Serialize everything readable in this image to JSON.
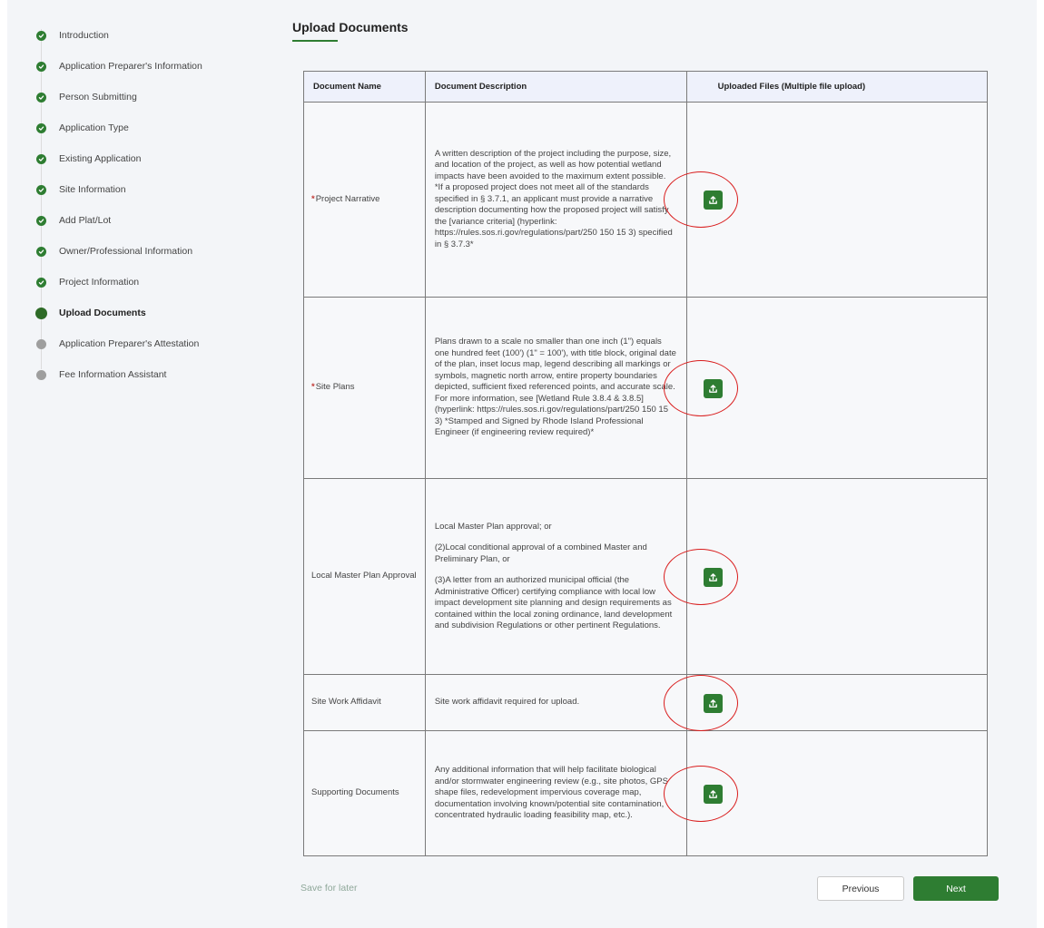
{
  "steps": [
    {
      "label": "Introduction",
      "status": "done"
    },
    {
      "label": "Application Preparer's Information",
      "status": "done"
    },
    {
      "label": "Person Submitting",
      "status": "done"
    },
    {
      "label": "Application Type",
      "status": "done"
    },
    {
      "label": "Existing Application",
      "status": "done"
    },
    {
      "label": "Site Information",
      "status": "done"
    },
    {
      "label": "Add Plat/Lot",
      "status": "done"
    },
    {
      "label": "Owner/Professional Information",
      "status": "done"
    },
    {
      "label": "Project Information",
      "status": "done"
    },
    {
      "label": "Upload Documents",
      "status": "current"
    },
    {
      "label": "Application Preparer's Attestation",
      "status": "todo"
    },
    {
      "label": "Fee Information Assistant",
      "status": "todo"
    }
  ],
  "page_title": "Upload Documents",
  "table": {
    "headers": {
      "name": "Document Name",
      "description": "Document Description",
      "files": "Uploaded Files (Multiple file upload)"
    },
    "rows": [
      {
        "required": true,
        "name": "Project Narrative",
        "description": [
          "A written description of the project including the purpose, size, and location of the project, as well as how potential wetland impacts have been avoided to the maximum extent possible.",
          "*If a proposed project does not meet all of the standards specified in § 3.7.1, an applicant must provide a narrative description documenting how the proposed project will satisfy the [variance criteria] (hyperlink: https://rules.sos.ri.gov/regulations/part/250 150 15 3) specified in § 3.7.3*"
        ]
      },
      {
        "required": true,
        "name": "Site Plans",
        "description": [
          "Plans drawn to a scale no smaller than one inch (1\") equals one hundred feet (100') (1\" = 100'), with title block, original date of the plan, inset locus map, legend describing all markings or symbols, magnetic north arrow, entire property boundaries depicted, sufficient fixed referenced points, and accurate scale. For more information, see [Wetland Rule 3.8.4 & 3.8.5](hyperlink: https://rules.sos.ri.gov/regulations/part/250 150 15 3) *Stamped and Signed by Rhode Island Professional Engineer (if engineering review required)*"
        ]
      },
      {
        "required": false,
        "name": "Local Master Plan Approval",
        "description_gapped": [
          "Local Master Plan approval; or",
          "(2)Local conditional approval of a combined Master and Preliminary Plan, or",
          "(3)A letter from an authorized municipal official (the Administrative Officer) certifying compliance with local low impact development site planning and design requirements as contained within the local zoning ordinance, land development and subdivision Regulations or other pertinent Regulations."
        ]
      },
      {
        "required": false,
        "name": "Site Work Affidavit",
        "description": [
          "Site work affidavit required for upload."
        ]
      },
      {
        "required": false,
        "name": "Supporting Documents",
        "description": [
          "Any additional information that will help facilitate biological and/or stormwater engineering review (e.g., site photos, GPS shape files, redevelopment impervious coverage map, documentation involving known/potential site contamination, concentrated hydraulic loading feasibility map, etc.)."
        ]
      }
    ]
  },
  "footer": {
    "save_later": "Save for later",
    "previous": "Previous",
    "next": "Next"
  },
  "colors": {
    "accent": "#2e7d32",
    "annotation_ring": "#d91c1c",
    "required_mark": "#c23934"
  },
  "icons": {
    "done": "check-circle-icon",
    "upload": "upload-icon"
  }
}
